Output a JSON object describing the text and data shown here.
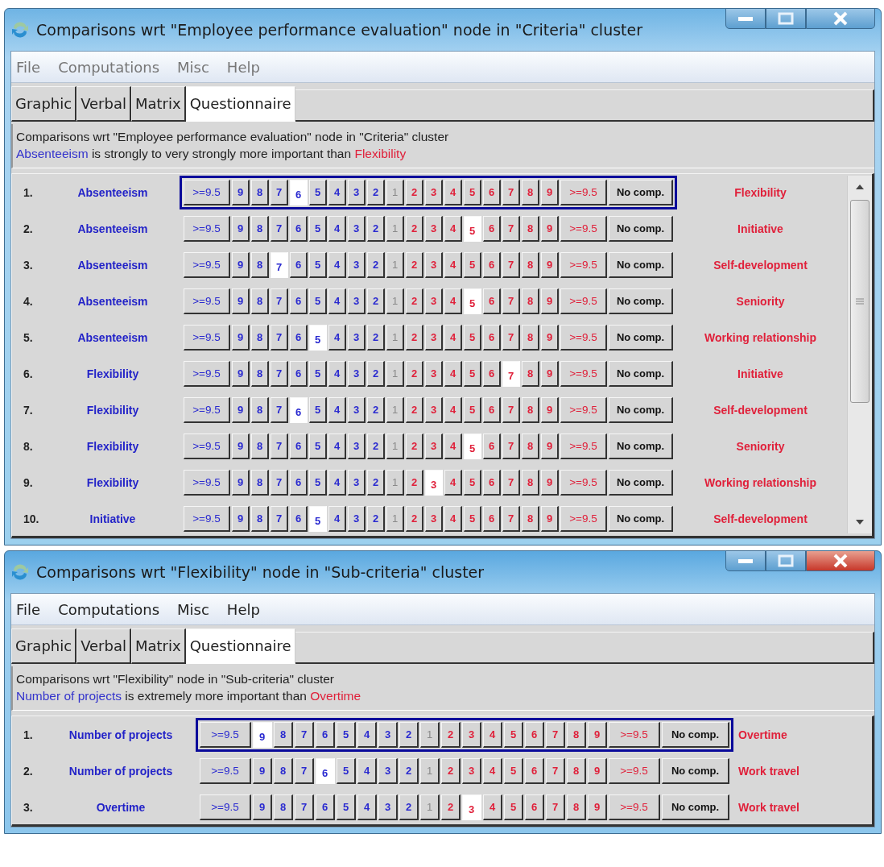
{
  "windows": [
    {
      "title": "Comparisons wrt \"Employee performance evaluation\" node in \"Criteria\" cluster",
      "active": false,
      "has_scrollbar": true,
      "menu": [
        "File",
        "Computations",
        "Misc",
        "Help"
      ],
      "tabs": [
        {
          "label": "Graphic",
          "selected": false
        },
        {
          "label": "Verbal",
          "selected": false
        },
        {
          "label": "Matrix",
          "selected": false
        },
        {
          "label": "Questionnaire",
          "selected": true
        }
      ],
      "info": {
        "heading": "Comparisons wrt \"Employee performance evaluation\" node in \"Criteria\" cluster",
        "verdict_left": "Absenteeism",
        "verdict_text": "is strongly to very strongly more important than",
        "verdict_right": "Flexibility"
      },
      "rows": [
        {
          "number": "1.",
          "left": "Absenteeism",
          "right": "Flexibility",
          "focused": true,
          "left_scale": [
            {
              "label": ">=9.5",
              "selected": false
            },
            {
              "label": "9",
              "selected": false
            },
            {
              "label": "8",
              "selected": false
            },
            {
              "label": "7",
              "selected": false
            },
            {
              "label": "6",
              "selected": true
            },
            {
              "label": "5",
              "selected": false
            },
            {
              "label": "4",
              "selected": false
            },
            {
              "label": "3",
              "selected": false
            },
            {
              "label": "2",
              "selected": false
            }
          ],
          "center": {
            "label": "1",
            "disabled": true
          },
          "right_scale": [
            {
              "label": "2",
              "selected": false
            },
            {
              "label": "3",
              "selected": false
            },
            {
              "label": "4",
              "selected": false
            },
            {
              "label": "5",
              "selected": false
            },
            {
              "label": "6",
              "selected": false
            },
            {
              "label": "7",
              "selected": false
            },
            {
              "label": "8",
              "selected": false
            },
            {
              "label": "9",
              "selected": false
            },
            {
              "label": ">=9.5",
              "selected": false
            }
          ],
          "no_comp": {
            "label": "No comp.",
            "selected": false
          }
        },
        {
          "number": "2.",
          "left": "Absenteeism",
          "right": "Initiative",
          "focused": false,
          "left_scale": [
            {
              "label": ">=9.5",
              "selected": false
            },
            {
              "label": "9",
              "selected": false
            },
            {
              "label": "8",
              "selected": false
            },
            {
              "label": "7",
              "selected": false
            },
            {
              "label": "6",
              "selected": false
            },
            {
              "label": "5",
              "selected": false
            },
            {
              "label": "4",
              "selected": false
            },
            {
              "label": "3",
              "selected": false
            },
            {
              "label": "2",
              "selected": false
            }
          ],
          "center": {
            "label": "1",
            "disabled": true
          },
          "right_scale": [
            {
              "label": "2",
              "selected": false
            },
            {
              "label": "3",
              "selected": false
            },
            {
              "label": "4",
              "selected": false
            },
            {
              "label": "5",
              "selected": true
            },
            {
              "label": "6",
              "selected": false
            },
            {
              "label": "7",
              "selected": false
            },
            {
              "label": "8",
              "selected": false
            },
            {
              "label": "9",
              "selected": false
            },
            {
              "label": ">=9.5",
              "selected": false
            }
          ],
          "no_comp": {
            "label": "No comp.",
            "selected": false
          }
        },
        {
          "number": "3.",
          "left": "Absenteeism",
          "right": "Self-development",
          "focused": false,
          "left_scale": [
            {
              "label": ">=9.5",
              "selected": false
            },
            {
              "label": "9",
              "selected": false
            },
            {
              "label": "8",
              "selected": false
            },
            {
              "label": "7",
              "selected": true
            },
            {
              "label": "6",
              "selected": false
            },
            {
              "label": "5",
              "selected": false
            },
            {
              "label": "4",
              "selected": false
            },
            {
              "label": "3",
              "selected": false
            },
            {
              "label": "2",
              "selected": false
            }
          ],
          "center": {
            "label": "1",
            "disabled": true
          },
          "right_scale": [
            {
              "label": "2",
              "selected": false
            },
            {
              "label": "3",
              "selected": false
            },
            {
              "label": "4",
              "selected": false
            },
            {
              "label": "5",
              "selected": false
            },
            {
              "label": "6",
              "selected": false
            },
            {
              "label": "7",
              "selected": false
            },
            {
              "label": "8",
              "selected": false
            },
            {
              "label": "9",
              "selected": false
            },
            {
              "label": ">=9.5",
              "selected": false
            }
          ],
          "no_comp": {
            "label": "No comp.",
            "selected": false
          }
        },
        {
          "number": "4.",
          "left": "Absenteeism",
          "right": "Seniority",
          "focused": false,
          "left_scale": [
            {
              "label": ">=9.5",
              "selected": false
            },
            {
              "label": "9",
              "selected": false
            },
            {
              "label": "8",
              "selected": false
            },
            {
              "label": "7",
              "selected": false
            },
            {
              "label": "6",
              "selected": false
            },
            {
              "label": "5",
              "selected": false
            },
            {
              "label": "4",
              "selected": false
            },
            {
              "label": "3",
              "selected": false
            },
            {
              "label": "2",
              "selected": false
            }
          ],
          "center": {
            "label": "1",
            "disabled": true
          },
          "right_scale": [
            {
              "label": "2",
              "selected": false
            },
            {
              "label": "3",
              "selected": false
            },
            {
              "label": "4",
              "selected": false
            },
            {
              "label": "5",
              "selected": true
            },
            {
              "label": "6",
              "selected": false
            },
            {
              "label": "7",
              "selected": false
            },
            {
              "label": "8",
              "selected": false
            },
            {
              "label": "9",
              "selected": false
            },
            {
              "label": ">=9.5",
              "selected": false
            }
          ],
          "no_comp": {
            "label": "No comp.",
            "selected": false
          }
        },
        {
          "number": "5.",
          "left": "Absenteeism",
          "right": "Working relationship",
          "focused": false,
          "left_scale": [
            {
              "label": ">=9.5",
              "selected": false
            },
            {
              "label": "9",
              "selected": false
            },
            {
              "label": "8",
              "selected": false
            },
            {
              "label": "7",
              "selected": false
            },
            {
              "label": "6",
              "selected": false
            },
            {
              "label": "5",
              "selected": true
            },
            {
              "label": "4",
              "selected": false
            },
            {
              "label": "3",
              "selected": false
            },
            {
              "label": "2",
              "selected": false
            }
          ],
          "center": {
            "label": "1",
            "disabled": true
          },
          "right_scale": [
            {
              "label": "2",
              "selected": false
            },
            {
              "label": "3",
              "selected": false
            },
            {
              "label": "4",
              "selected": false
            },
            {
              "label": "5",
              "selected": false
            },
            {
              "label": "6",
              "selected": false
            },
            {
              "label": "7",
              "selected": false
            },
            {
              "label": "8",
              "selected": false
            },
            {
              "label": "9",
              "selected": false
            },
            {
              "label": ">=9.5",
              "selected": false
            }
          ],
          "no_comp": {
            "label": "No comp.",
            "selected": false
          }
        },
        {
          "number": "6.",
          "left": "Flexibility",
          "right": "Initiative",
          "focused": false,
          "left_scale": [
            {
              "label": ">=9.5",
              "selected": false
            },
            {
              "label": "9",
              "selected": false
            },
            {
              "label": "8",
              "selected": false
            },
            {
              "label": "7",
              "selected": false
            },
            {
              "label": "6",
              "selected": false
            },
            {
              "label": "5",
              "selected": false
            },
            {
              "label": "4",
              "selected": false
            },
            {
              "label": "3",
              "selected": false
            },
            {
              "label": "2",
              "selected": false
            }
          ],
          "center": {
            "label": "1",
            "disabled": true
          },
          "right_scale": [
            {
              "label": "2",
              "selected": false
            },
            {
              "label": "3",
              "selected": false
            },
            {
              "label": "4",
              "selected": false
            },
            {
              "label": "5",
              "selected": false
            },
            {
              "label": "6",
              "selected": false
            },
            {
              "label": "7",
              "selected": true
            },
            {
              "label": "8",
              "selected": false
            },
            {
              "label": "9",
              "selected": false
            },
            {
              "label": ">=9.5",
              "selected": false
            }
          ],
          "no_comp": {
            "label": "No comp.",
            "selected": false
          }
        },
        {
          "number": "7.",
          "left": "Flexibility",
          "right": "Self-development",
          "focused": false,
          "left_scale": [
            {
              "label": ">=9.5",
              "selected": false
            },
            {
              "label": "9",
              "selected": false
            },
            {
              "label": "8",
              "selected": false
            },
            {
              "label": "7",
              "selected": false
            },
            {
              "label": "6",
              "selected": true
            },
            {
              "label": "5",
              "selected": false
            },
            {
              "label": "4",
              "selected": false
            },
            {
              "label": "3",
              "selected": false
            },
            {
              "label": "2",
              "selected": false
            }
          ],
          "center": {
            "label": "1",
            "disabled": true
          },
          "right_scale": [
            {
              "label": "2",
              "selected": false
            },
            {
              "label": "3",
              "selected": false
            },
            {
              "label": "4",
              "selected": false
            },
            {
              "label": "5",
              "selected": false
            },
            {
              "label": "6",
              "selected": false
            },
            {
              "label": "7",
              "selected": false
            },
            {
              "label": "8",
              "selected": false
            },
            {
              "label": "9",
              "selected": false
            },
            {
              "label": ">=9.5",
              "selected": false
            }
          ],
          "no_comp": {
            "label": "No comp.",
            "selected": false
          }
        },
        {
          "number": "8.",
          "left": "Flexibility",
          "right": "Seniority",
          "focused": false,
          "left_scale": [
            {
              "label": ">=9.5",
              "selected": false
            },
            {
              "label": "9",
              "selected": false
            },
            {
              "label": "8",
              "selected": false
            },
            {
              "label": "7",
              "selected": false
            },
            {
              "label": "6",
              "selected": false
            },
            {
              "label": "5",
              "selected": false
            },
            {
              "label": "4",
              "selected": false
            },
            {
              "label": "3",
              "selected": false
            },
            {
              "label": "2",
              "selected": false
            }
          ],
          "center": {
            "label": "1",
            "disabled": true
          },
          "right_scale": [
            {
              "label": "2",
              "selected": false
            },
            {
              "label": "3",
              "selected": false
            },
            {
              "label": "4",
              "selected": false
            },
            {
              "label": "5",
              "selected": true
            },
            {
              "label": "6",
              "selected": false
            },
            {
              "label": "7",
              "selected": false
            },
            {
              "label": "8",
              "selected": false
            },
            {
              "label": "9",
              "selected": false
            },
            {
              "label": ">=9.5",
              "selected": false
            }
          ],
          "no_comp": {
            "label": "No comp.",
            "selected": false
          }
        },
        {
          "number": "9.",
          "left": "Flexibility",
          "right": "Working relationship",
          "focused": false,
          "left_scale": [
            {
              "label": ">=9.5",
              "selected": false
            },
            {
              "label": "9",
              "selected": false
            },
            {
              "label": "8",
              "selected": false
            },
            {
              "label": "7",
              "selected": false
            },
            {
              "label": "6",
              "selected": false
            },
            {
              "label": "5",
              "selected": false
            },
            {
              "label": "4",
              "selected": false
            },
            {
              "label": "3",
              "selected": false
            },
            {
              "label": "2",
              "selected": false
            }
          ],
          "center": {
            "label": "1",
            "disabled": true
          },
          "right_scale": [
            {
              "label": "2",
              "selected": false
            },
            {
              "label": "3",
              "selected": true
            },
            {
              "label": "4",
              "selected": false
            },
            {
              "label": "5",
              "selected": false
            },
            {
              "label": "6",
              "selected": false
            },
            {
              "label": "7",
              "selected": false
            },
            {
              "label": "8",
              "selected": false
            },
            {
              "label": "9",
              "selected": false
            },
            {
              "label": ">=9.5",
              "selected": false
            }
          ],
          "no_comp": {
            "label": "No comp.",
            "selected": false
          }
        },
        {
          "number": "10.",
          "left": "Initiative",
          "right": "Self-development",
          "focused": false,
          "left_scale": [
            {
              "label": ">=9.5",
              "selected": false
            },
            {
              "label": "9",
              "selected": false
            },
            {
              "label": "8",
              "selected": false
            },
            {
              "label": "7",
              "selected": false
            },
            {
              "label": "6",
              "selected": false
            },
            {
              "label": "5",
              "selected": true
            },
            {
              "label": "4",
              "selected": false
            },
            {
              "label": "3",
              "selected": false
            },
            {
              "label": "2",
              "selected": false
            }
          ],
          "center": {
            "label": "1",
            "disabled": true
          },
          "right_scale": [
            {
              "label": "2",
              "selected": false
            },
            {
              "label": "3",
              "selected": false
            },
            {
              "label": "4",
              "selected": false
            },
            {
              "label": "5",
              "selected": false
            },
            {
              "label": "6",
              "selected": false
            },
            {
              "label": "7",
              "selected": false
            },
            {
              "label": "8",
              "selected": false
            },
            {
              "label": "9",
              "selected": false
            },
            {
              "label": ">=9.5",
              "selected": false
            }
          ],
          "no_comp": {
            "label": "No comp.",
            "selected": false
          }
        }
      ]
    },
    {
      "title": "Comparisons wrt \"Flexibility\" node in \"Sub-criteria\" cluster",
      "active": true,
      "has_scrollbar": false,
      "menu": [
        "File",
        "Computations",
        "Misc",
        "Help"
      ],
      "tabs": [
        {
          "label": "Graphic",
          "selected": false
        },
        {
          "label": "Verbal",
          "selected": false
        },
        {
          "label": "Matrix",
          "selected": false
        },
        {
          "label": "Questionnaire",
          "selected": true
        }
      ],
      "info": {
        "heading": "Comparisons wrt \"Flexibility\" node in \"Sub-criteria\" cluster",
        "verdict_left": "Number of projects",
        "verdict_text": "is extremely more important than",
        "verdict_right": "Overtime"
      },
      "rows": [
        {
          "number": "1.",
          "left": "Number of projects",
          "right": "Overtime",
          "focused": true,
          "left_scale": [
            {
              "label": ">=9.5",
              "selected": false
            },
            {
              "label": "9",
              "selected": true
            },
            {
              "label": "8",
              "selected": false
            },
            {
              "label": "7",
              "selected": false
            },
            {
              "label": "6",
              "selected": false
            },
            {
              "label": "5",
              "selected": false
            },
            {
              "label": "4",
              "selected": false
            },
            {
              "label": "3",
              "selected": false
            },
            {
              "label": "2",
              "selected": false
            }
          ],
          "center": {
            "label": "1",
            "disabled": true
          },
          "right_scale": [
            {
              "label": "2",
              "selected": false
            },
            {
              "label": "3",
              "selected": false
            },
            {
              "label": "4",
              "selected": false
            },
            {
              "label": "5",
              "selected": false
            },
            {
              "label": "6",
              "selected": false
            },
            {
              "label": "7",
              "selected": false
            },
            {
              "label": "8",
              "selected": false
            },
            {
              "label": "9",
              "selected": false
            },
            {
              "label": ">=9.5",
              "selected": false
            }
          ],
          "no_comp": {
            "label": "No comp.",
            "selected": false
          }
        },
        {
          "number": "2.",
          "left": "Number of projects",
          "right": "Work travel",
          "focused": false,
          "left_scale": [
            {
              "label": ">=9.5",
              "selected": false
            },
            {
              "label": "9",
              "selected": false
            },
            {
              "label": "8",
              "selected": false
            },
            {
              "label": "7",
              "selected": false
            },
            {
              "label": "6",
              "selected": true
            },
            {
              "label": "5",
              "selected": false
            },
            {
              "label": "4",
              "selected": false
            },
            {
              "label": "3",
              "selected": false
            },
            {
              "label": "2",
              "selected": false
            }
          ],
          "center": {
            "label": "1",
            "disabled": true
          },
          "right_scale": [
            {
              "label": "2",
              "selected": false
            },
            {
              "label": "3",
              "selected": false
            },
            {
              "label": "4",
              "selected": false
            },
            {
              "label": "5",
              "selected": false
            },
            {
              "label": "6",
              "selected": false
            },
            {
              "label": "7",
              "selected": false
            },
            {
              "label": "8",
              "selected": false
            },
            {
              "label": "9",
              "selected": false
            },
            {
              "label": ">=9.5",
              "selected": false
            }
          ],
          "no_comp": {
            "label": "No comp.",
            "selected": false
          }
        },
        {
          "number": "3.",
          "left": "Overtime",
          "right": "Work travel",
          "focused": false,
          "left_scale": [
            {
              "label": ">=9.5",
              "selected": false
            },
            {
              "label": "9",
              "selected": false
            },
            {
              "label": "8",
              "selected": false
            },
            {
              "label": "7",
              "selected": false
            },
            {
              "label": "6",
              "selected": false
            },
            {
              "label": "5",
              "selected": false
            },
            {
              "label": "4",
              "selected": false
            },
            {
              "label": "3",
              "selected": false
            },
            {
              "label": "2",
              "selected": false
            }
          ],
          "center": {
            "label": "1",
            "disabled": true
          },
          "right_scale": [
            {
              "label": "2",
              "selected": false
            },
            {
              "label": "3",
              "selected": true
            },
            {
              "label": "4",
              "selected": false
            },
            {
              "label": "5",
              "selected": false
            },
            {
              "label": "6",
              "selected": false
            },
            {
              "label": "7",
              "selected": false
            },
            {
              "label": "8",
              "selected": false
            },
            {
              "label": "9",
              "selected": false
            },
            {
              "label": ">=9.5",
              "selected": false
            }
          ],
          "no_comp": {
            "label": "No comp.",
            "selected": false
          }
        }
      ]
    }
  ]
}
